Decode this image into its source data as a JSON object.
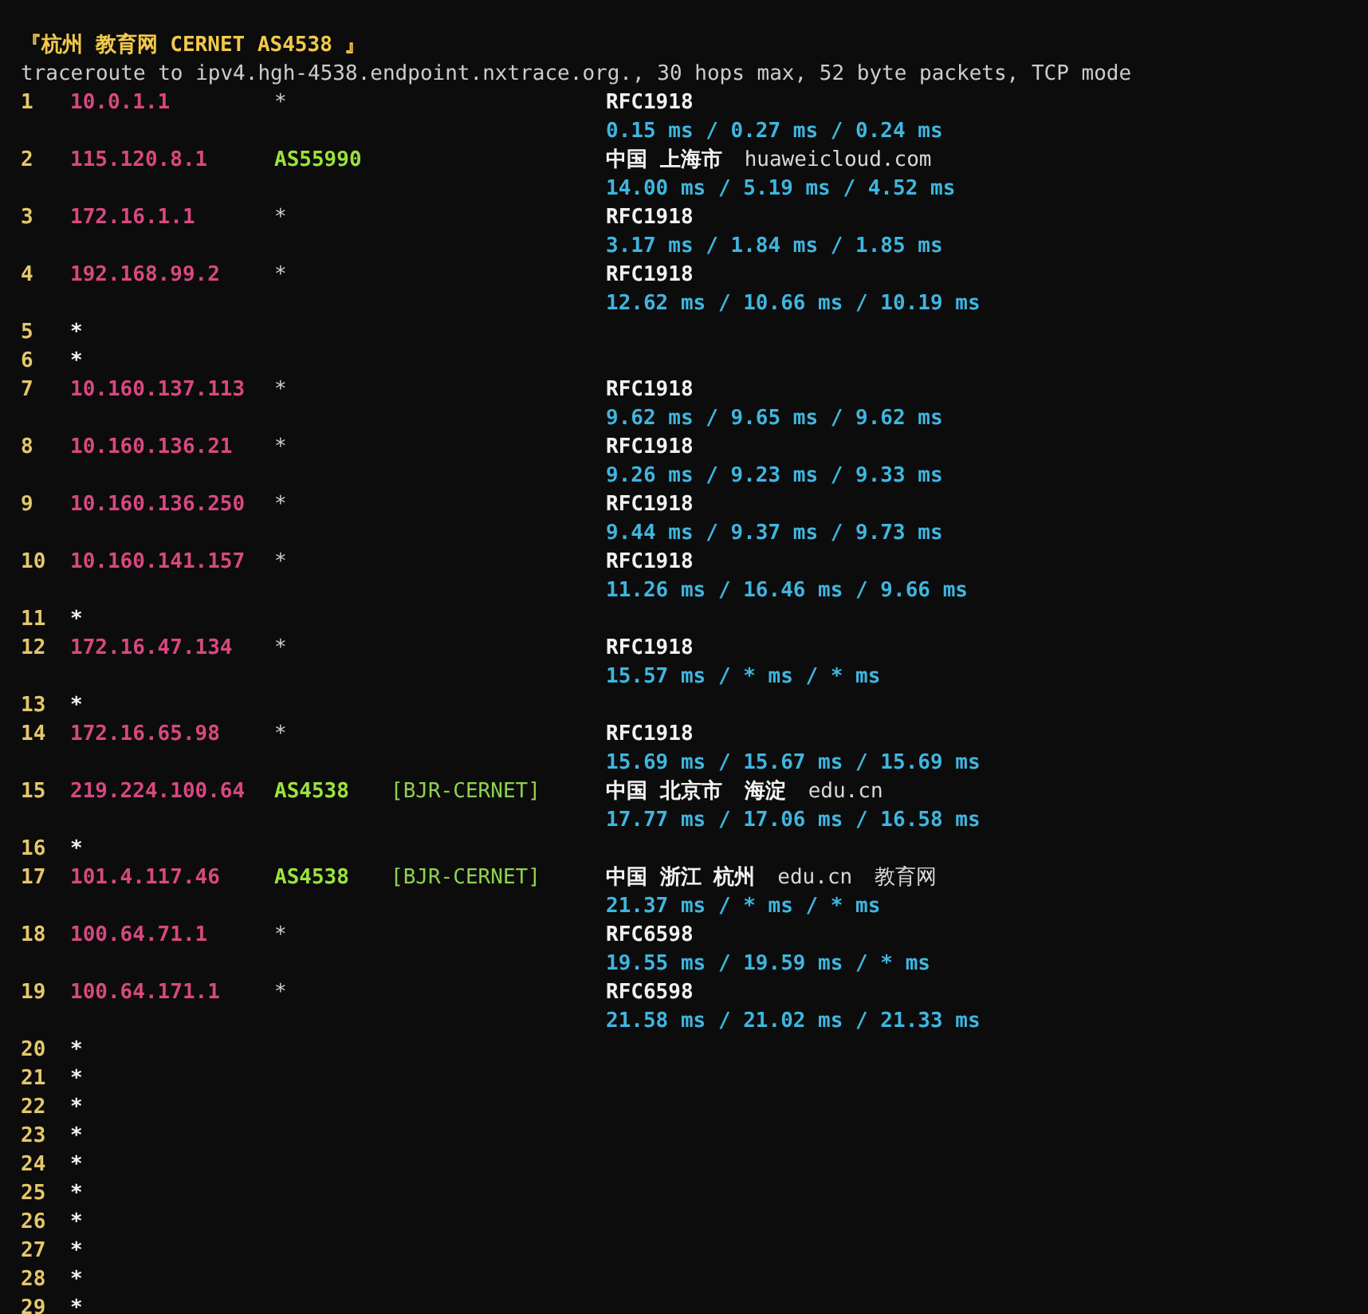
{
  "title": "『杭州 教育网 CERNET AS4538 』",
  "command": "traceroute to ipv4.hgh-4538.endpoint.nxtrace.org., 30 hops max, 52 byte packets, TCP mode",
  "hops": [
    {
      "kind": "reply",
      "num": "1",
      "ip": "10.0.1.1",
      "asn": "*",
      "geo": [
        {
          "kind": "place",
          "text": "RFC1918"
        }
      ],
      "rtt": "0.15 ms / 0.27 ms / 0.24 ms"
    },
    {
      "kind": "reply",
      "num": "2",
      "ip": "115.120.8.1",
      "asn": "AS55990",
      "geo": [
        {
          "kind": "place",
          "text": "中国 上海市"
        },
        {
          "kind": "domain",
          "text": "huaweicloud.com"
        }
      ],
      "rtt": "14.00 ms / 5.19 ms / 4.52 ms"
    },
    {
      "kind": "reply",
      "num": "3",
      "ip": "172.16.1.1",
      "asn": "*",
      "geo": [
        {
          "kind": "place",
          "text": "RFC1918"
        }
      ],
      "rtt": "3.17 ms / 1.84 ms / 1.85 ms"
    },
    {
      "kind": "reply",
      "num": "4",
      "ip": "192.168.99.2",
      "asn": "*",
      "geo": [
        {
          "kind": "place",
          "text": "RFC1918"
        }
      ],
      "rtt": "12.62 ms / 10.66 ms / 10.19 ms"
    },
    {
      "kind": "timeout",
      "num": "5",
      "mark": "*"
    },
    {
      "kind": "timeout",
      "num": "6",
      "mark": "*"
    },
    {
      "kind": "reply",
      "num": "7",
      "ip": "10.160.137.113",
      "asn": "*",
      "geo": [
        {
          "kind": "place",
          "text": "RFC1918"
        }
      ],
      "rtt": "9.62 ms / 9.65 ms / 9.62 ms"
    },
    {
      "kind": "reply",
      "num": "8",
      "ip": "10.160.136.21",
      "asn": "*",
      "geo": [
        {
          "kind": "place",
          "text": "RFC1918"
        }
      ],
      "rtt": "9.26 ms / 9.23 ms / 9.33 ms"
    },
    {
      "kind": "reply",
      "num": "9",
      "ip": "10.160.136.250",
      "asn": "*",
      "geo": [
        {
          "kind": "place",
          "text": "RFC1918"
        }
      ],
      "rtt": "9.44 ms / 9.37 ms / 9.73 ms"
    },
    {
      "kind": "reply",
      "num": "10",
      "ip": "10.160.141.157",
      "asn": "*",
      "geo": [
        {
          "kind": "place",
          "text": "RFC1918"
        }
      ],
      "rtt": "11.26 ms / 16.46 ms / 9.66 ms"
    },
    {
      "kind": "timeout",
      "num": "11",
      "mark": "*"
    },
    {
      "kind": "reply",
      "num": "12",
      "ip": "172.16.47.134",
      "asn": "*",
      "geo": [
        {
          "kind": "place",
          "text": "RFC1918"
        }
      ],
      "rtt": "15.57 ms / * ms / * ms"
    },
    {
      "kind": "timeout",
      "num": "13",
      "mark": "*"
    },
    {
      "kind": "reply",
      "num": "14",
      "ip": "172.16.65.98",
      "asn": "*",
      "geo": [
        {
          "kind": "place",
          "text": "RFC1918"
        }
      ],
      "rtt": "15.69 ms / 15.67 ms / 15.69 ms"
    },
    {
      "kind": "reply",
      "num": "15",
      "ip": "219.224.100.64",
      "asn": "AS4538",
      "tag": "[BJR-CERNET]",
      "geo": [
        {
          "kind": "place",
          "text": "中国 北京市"
        },
        {
          "kind": "place",
          "text": "海淀"
        },
        {
          "kind": "domain",
          "text": "edu.cn"
        }
      ],
      "rtt": "17.77 ms / 17.06 ms / 16.58 ms"
    },
    {
      "kind": "timeout",
      "num": "16",
      "mark": "*"
    },
    {
      "kind": "reply",
      "num": "17",
      "ip": "101.4.117.46",
      "asn": "AS4538",
      "tag": "[BJR-CERNET]",
      "geo": [
        {
          "kind": "place",
          "text": "中国 浙江 杭州"
        },
        {
          "kind": "domain",
          "text": "edu.cn"
        },
        {
          "kind": "domain",
          "text": "教育网"
        }
      ],
      "rtt": "21.37 ms / * ms / * ms"
    },
    {
      "kind": "reply",
      "num": "18",
      "ip": "100.64.71.1",
      "asn": "*",
      "geo": [
        {
          "kind": "place",
          "text": "RFC6598"
        }
      ],
      "rtt": "19.55 ms / 19.59 ms / * ms"
    },
    {
      "kind": "reply",
      "num": "19",
      "ip": "100.64.171.1",
      "asn": "*",
      "geo": [
        {
          "kind": "place",
          "text": "RFC6598"
        }
      ],
      "rtt": "21.58 ms / 21.02 ms / 21.33 ms"
    },
    {
      "kind": "timeout",
      "num": "20",
      "mark": "*"
    },
    {
      "kind": "timeout",
      "num": "21",
      "mark": "*"
    },
    {
      "kind": "timeout",
      "num": "22",
      "mark": "*"
    },
    {
      "kind": "timeout",
      "num": "23",
      "mark": "*"
    },
    {
      "kind": "timeout",
      "num": "24",
      "mark": "*"
    },
    {
      "kind": "timeout",
      "num": "25",
      "mark": "*"
    },
    {
      "kind": "timeout",
      "num": "26",
      "mark": "*"
    },
    {
      "kind": "timeout",
      "num": "27",
      "mark": "*"
    },
    {
      "kind": "timeout",
      "num": "28",
      "mark": "*"
    },
    {
      "kind": "timeout",
      "num": "29",
      "mark": "*"
    }
  ]
}
